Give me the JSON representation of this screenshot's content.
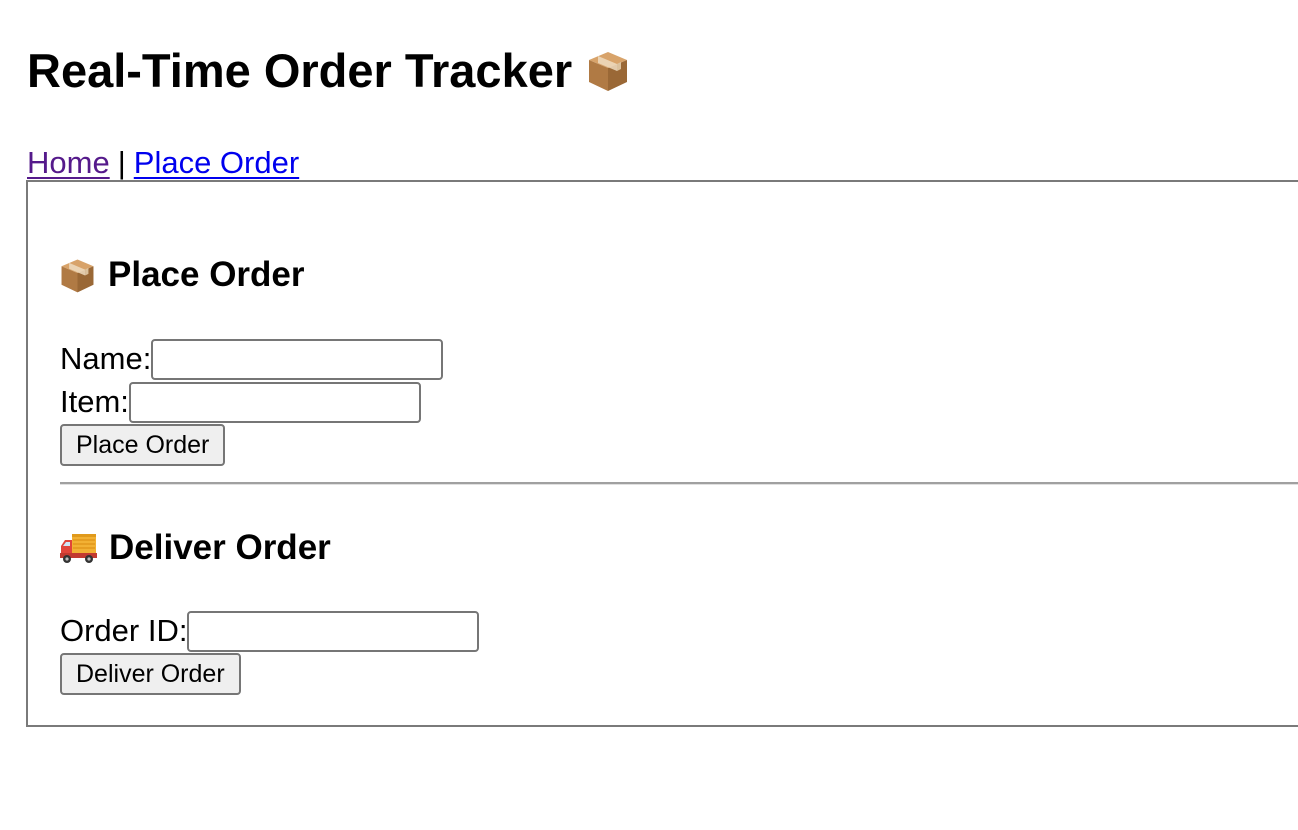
{
  "header": {
    "title": "Real-Time Order Tracker",
    "title_icon": "package-icon"
  },
  "nav": {
    "home_label": "Home",
    "separator": "|",
    "place_order_label": "Place Order",
    "link_color": "#0000ee",
    "visited_link_color": "#551a8b"
  },
  "place_order": {
    "icon": "package-icon",
    "heading": "Place Order",
    "name_label": "Name:",
    "name_value": "",
    "item_label": "Item:",
    "item_value": "",
    "submit_label": "Place Order"
  },
  "deliver_order": {
    "icon": "delivery-truck-icon",
    "heading": "Deliver Order",
    "order_id_label": "Order ID:",
    "order_id_value": "",
    "submit_label": "Deliver Order"
  }
}
